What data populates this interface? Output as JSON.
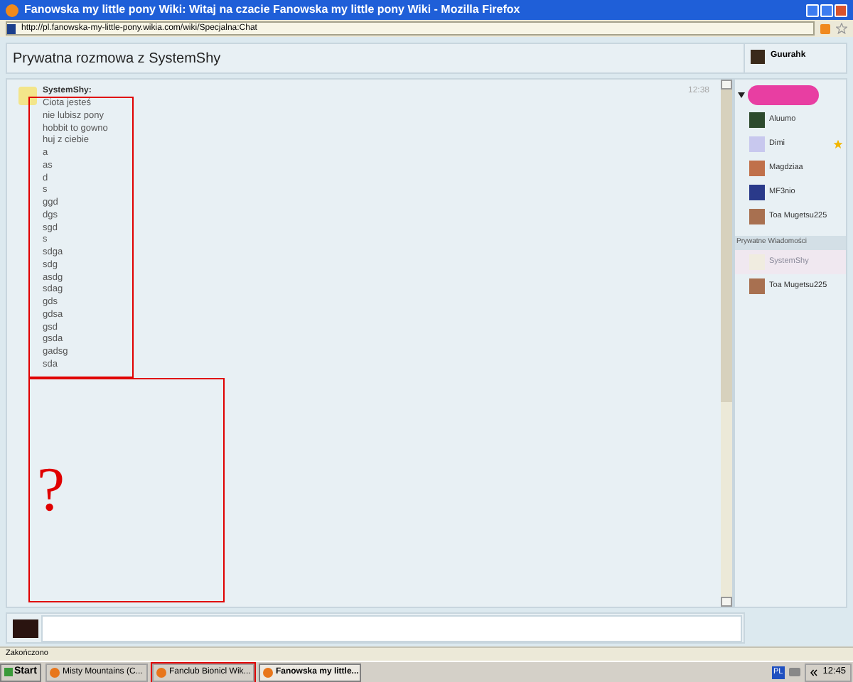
{
  "window": {
    "title": "Fanowska my little pony Wiki: Witaj na czacie Fanowska my little pony Wiki - Mozilla Firefox"
  },
  "address_bar": {
    "url": "http://pl.fanowska-my-little-pony.wikia.com/wiki/Specjalna:Chat"
  },
  "chat": {
    "title": "Prywatna rozmowa z SystemShy",
    "current_user": "Guurahk",
    "message": {
      "author": "SystemShy:",
      "time": "12:38",
      "lines": [
        "Ciota jesteś",
        "nie lubisz pony",
        "hobbit to gowno",
        "huj z ciebie",
        "a",
        "as",
        "d",
        "s",
        "ggd",
        "dgs",
        "sgd",
        "s",
        "sdga",
        "sdg",
        "asdg",
        "sdag",
        "gds",
        "gdsa",
        "gsd",
        "gsda",
        "gadsg",
        "sda"
      ]
    },
    "annotation": {
      "mark": "?"
    }
  },
  "users": [
    {
      "name": "Aluumo",
      "starred": false
    },
    {
      "name": "Dimi",
      "starred": true
    },
    {
      "name": "Magdziaa",
      "starred": false
    },
    {
      "name": "MF3nio",
      "starred": false
    },
    {
      "name": "Toa Mugetsu225",
      "starred": false
    }
  ],
  "private_messages": {
    "header": "Prywatne Wiadomości",
    "items": [
      {
        "name": "SystemShy",
        "selected": true
      },
      {
        "name": "Toa Mugetsu225",
        "selected": false
      }
    ]
  },
  "status_bar": "Zakończono",
  "taskbar": {
    "start": "Start",
    "items": [
      {
        "label": "Misty Mountains (C...",
        "active": false,
        "outlined": false
      },
      {
        "label": "Fanclub Bionicl Wik...",
        "active": false,
        "outlined": true
      },
      {
        "label": "Fanowska my little...",
        "active": true,
        "outlined": false
      }
    ],
    "language": "PL",
    "clock": "12:45"
  }
}
